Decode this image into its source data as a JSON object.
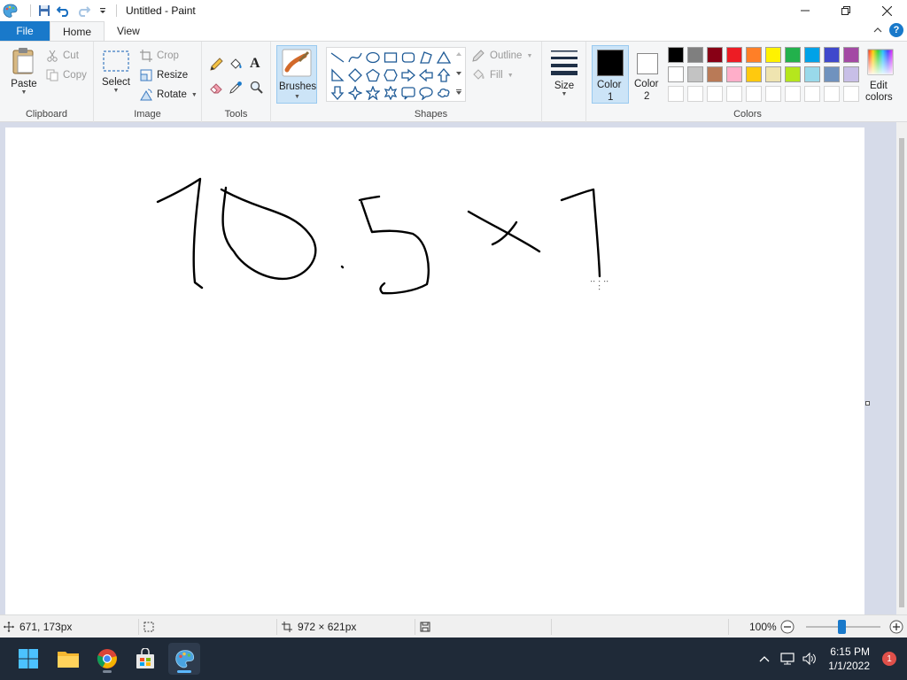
{
  "window": {
    "title": "Untitled - Paint"
  },
  "tabs": {
    "file": "File",
    "home": "Home",
    "view": "View"
  },
  "help": {
    "label": "?"
  },
  "clipboard": {
    "paste": "Paste",
    "cut": "Cut",
    "copy": "Copy",
    "group": "Clipboard"
  },
  "image": {
    "select": "Select",
    "crop": "Crop",
    "resize": "Resize",
    "rotate": "Rotate",
    "group": "Image"
  },
  "tools": {
    "group": "Tools",
    "text_glyph": "A"
  },
  "brushes": {
    "label": "Brushes"
  },
  "shapes": {
    "outline": "Outline",
    "fill": "Fill",
    "group": "Shapes"
  },
  "size": {
    "label": "Size"
  },
  "colors": {
    "color1_label": "Color",
    "color1_num": "1",
    "color2_label": "Color",
    "color2_num": "2",
    "edit_line1": "Edit",
    "edit_line2": "colors",
    "group": "Colors",
    "color1": "#000000",
    "color2": "#ffffff",
    "palette_row1": [
      "#000000",
      "#7f7f7f",
      "#880015",
      "#ed1c24",
      "#ff7f27",
      "#fff200",
      "#22b14c",
      "#00a2e8",
      "#3f48cc",
      "#a349a4"
    ],
    "palette_row2": [
      "#ffffff",
      "#c3c3c3",
      "#b97a57",
      "#ffaec9",
      "#ffc90e",
      "#efe4b0",
      "#b5e61d",
      "#99d9ea",
      "#7092be",
      "#c8bfe7"
    ]
  },
  "status": {
    "cursor_pos": "671, 173px",
    "canvas_size": "972 × 621px",
    "zoom": "100%"
  },
  "taskbar": {
    "time": "6:15 PM",
    "date": "1/1/2022",
    "notifications": "1"
  }
}
